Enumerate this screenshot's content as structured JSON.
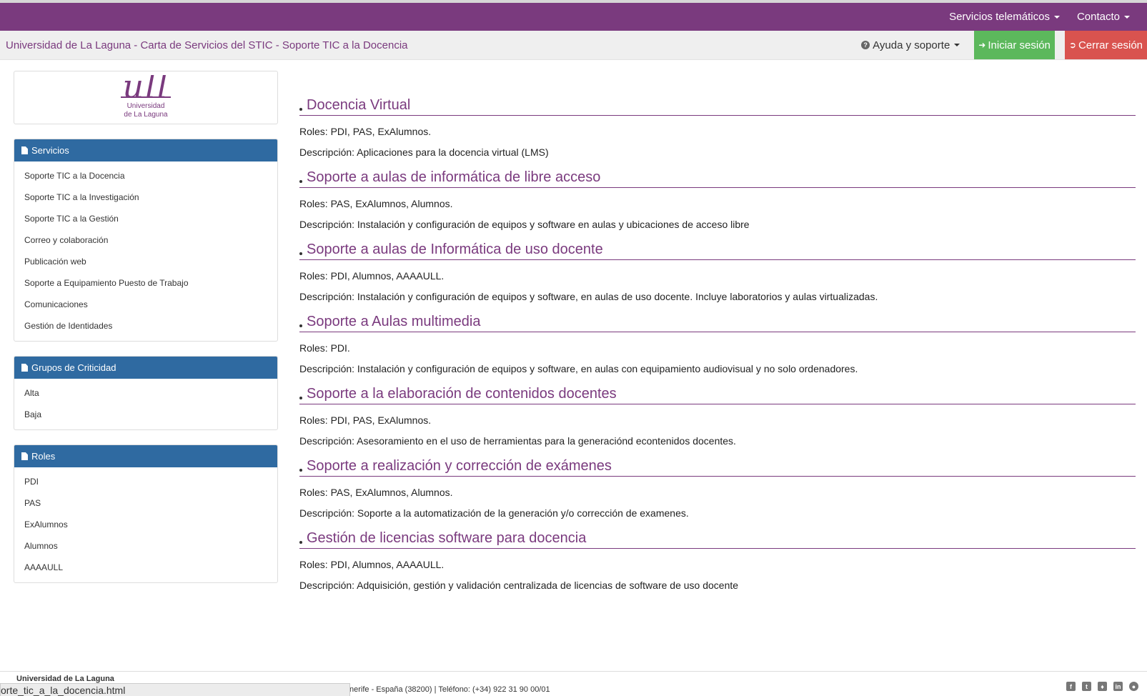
{
  "topbar": {
    "services_label": "Servicios telemáticos",
    "contact_label": "Contacto"
  },
  "subbar": {
    "title": "Universidad de La Laguna - Carta de Servicios del STIC - Soporte TIC a la Docencia",
    "help_label": "Ayuda y soporte",
    "login_label": "Iniciar sesión",
    "logout_label": "Cerrar sesión"
  },
  "logo": {
    "mark": "ull",
    "line1": "Universidad",
    "line2": "de La Laguna"
  },
  "sidebar": {
    "servicios": {
      "heading": "Servicios",
      "items": [
        "Soporte TIC a la Docencia",
        "Soporte TIC a la Investigación",
        "Soporte TIC a la Gestión",
        "Correo y colaboración",
        "Publicación web",
        "Soporte a Equipamiento Puesto de Trabajo",
        "Comunicaciones",
        "Gestión de Identidades"
      ]
    },
    "criticidad": {
      "heading": "Grupos de Criticidad",
      "items": [
        "Alta",
        "Baja"
      ]
    },
    "roles": {
      "heading": "Roles",
      "items": [
        "PDI",
        "PAS",
        "ExAlumnos",
        "Alumnos",
        "AAAAULL"
      ]
    }
  },
  "services": [
    {
      "title": "Docencia Virtual",
      "roles": "Roles: PDI, PAS, ExAlumnos.",
      "description": "Descripción: Aplicaciones para la docencia virtual (LMS)"
    },
    {
      "title": "Soporte a aulas de informática de libre acceso",
      "roles": "Roles: PAS, ExAlumnos, Alumnos.",
      "description": "Descripción: Instalación y configuración de equipos y software en aulas y ubicaciones de acceso libre"
    },
    {
      "title": "Soporte a aulas de Informática de uso docente",
      "roles": "Roles: PDI, Alumnos, AAAAULL.",
      "description": "Descripción: Instalación y configuración de equipos y software, en aulas de uso docente. Incluye laboratorios y aulas virtualizadas."
    },
    {
      "title": "Soporte a Aulas multimedia",
      "roles": "Roles: PDI.",
      "description": "Descripción: Instalación y configuración de equipos y software, en aulas con equipamiento audiovisual y no solo ordenadores."
    },
    {
      "title": "Soporte a la elaboración de contenidos docentes",
      "roles": "Roles: PDI, PAS, ExAlumnos.",
      "description": "Descripción: Asesoramiento en el uso de herramientas para la generaciónd econtenidos docentes."
    },
    {
      "title": "Soporte a realización y corrección de exámenes",
      "roles": "Roles: PAS, ExAlumnos, Alumnos.",
      "description": "Descripción: Soporte a la automatización de la generación y/o corrección de examenes."
    },
    {
      "title": "Gestión de licencias software para docencia",
      "roles": "Roles: PDI, Alumnos, AAAAULL.",
      "description": "Descripción: Adquisición, gestión y validación centralizada de licencias de software de uso docente"
    }
  ],
  "footer": {
    "name": "Universidad de La Laguna",
    "address": "nerife - España (38200) | Teléfono: (+34) 922 31 90 00/01",
    "status_url": "orte_tic_a_la_docencia.html",
    "social_icons": [
      "facebook-icon",
      "tumblr-icon",
      "twitter-icon",
      "linkedin-icon",
      "web-icon"
    ]
  },
  "colors": {
    "brand_purple": "#7a3a7e",
    "panel_blue": "#2f6aa1",
    "login_green": "#5cb85c",
    "logout_red": "#d9534f"
  }
}
